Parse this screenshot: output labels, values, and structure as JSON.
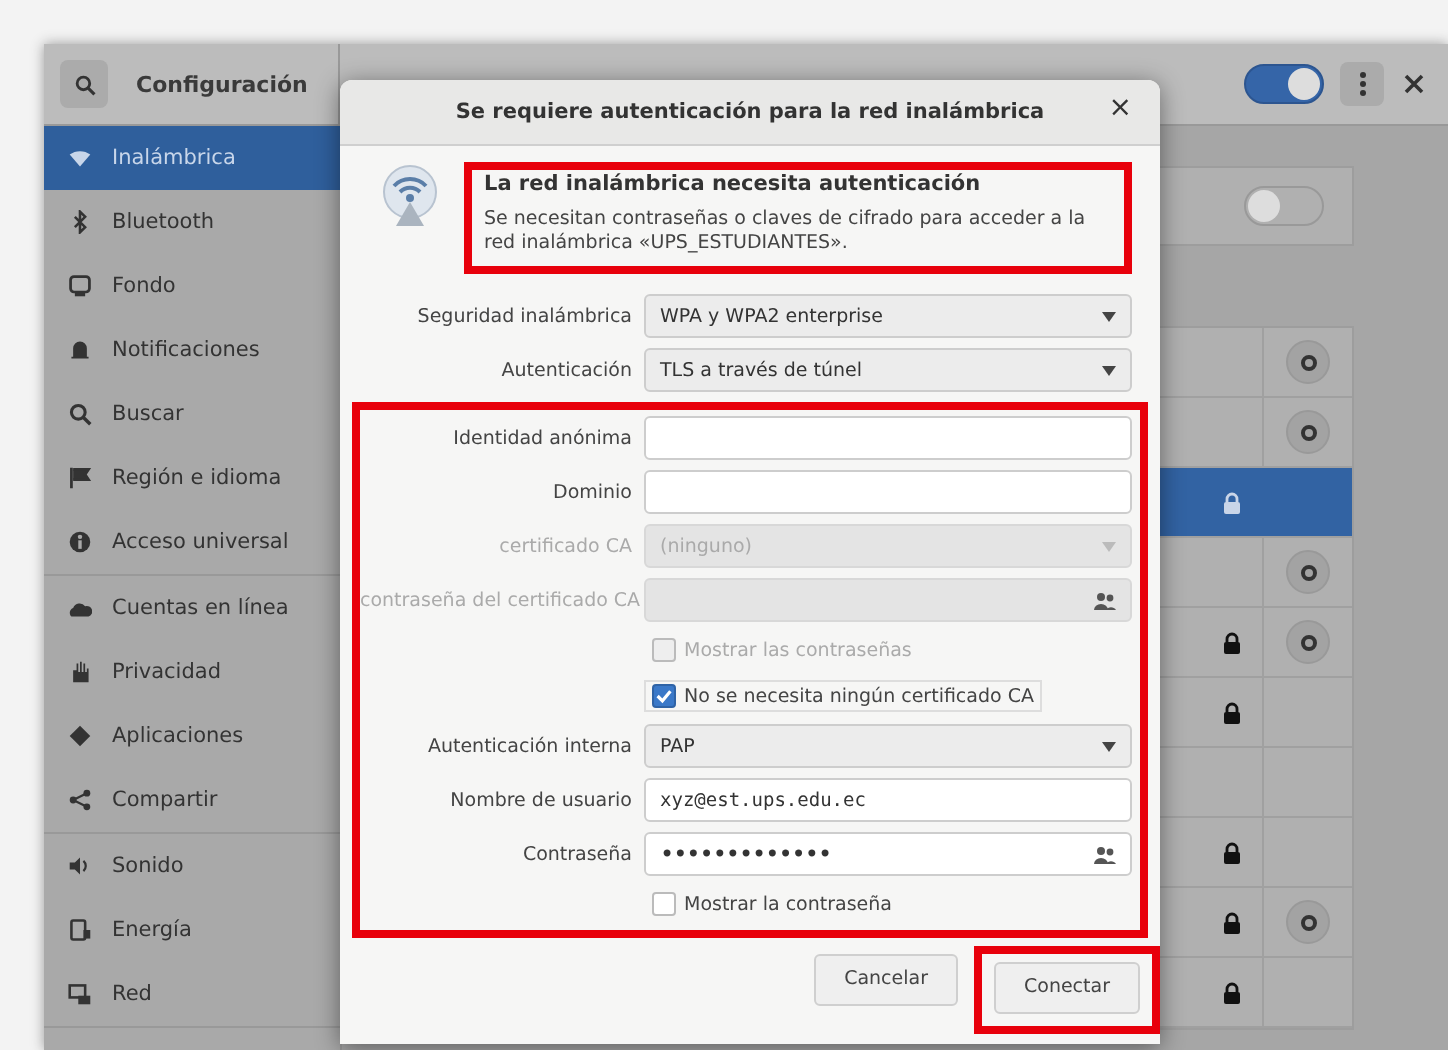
{
  "header": {
    "title": "Configuración",
    "wifi_on": true
  },
  "sidebar": {
    "groups": [
      {
        "items": [
          {
            "label": "Inalámbrica",
            "selected": true
          },
          {
            "label": "Bluetooth",
            "selected": false
          },
          {
            "label": "Fondo",
            "selected": false
          },
          {
            "label": "Notificaciones",
            "selected": false
          },
          {
            "label": "Buscar",
            "selected": false
          },
          {
            "label": "Región e idioma",
            "selected": false
          },
          {
            "label": "Acceso universal",
            "selected": false
          }
        ]
      },
      {
        "items": [
          {
            "label": "Cuentas en línea",
            "selected": false
          },
          {
            "label": "Privacidad",
            "selected": false
          },
          {
            "label": "Aplicaciones",
            "selected": false
          },
          {
            "label": "Compartir",
            "selected": false
          }
        ]
      },
      {
        "items": [
          {
            "label": "Sonido",
            "selected": false
          },
          {
            "label": "Energía",
            "selected": false
          },
          {
            "label": "Red",
            "selected": false
          }
        ]
      }
    ]
  },
  "background": {
    "toggle_on": false,
    "networks": [
      {
        "secured": false,
        "configured": true,
        "selected": false
      },
      {
        "secured": false,
        "configured": true,
        "selected": false
      },
      {
        "secured": true,
        "configured": false,
        "selected": true
      },
      {
        "secured": false,
        "configured": true,
        "selected": false
      },
      {
        "secured": true,
        "configured": true,
        "selected": false
      },
      {
        "secured": true,
        "configured": false,
        "selected": false
      },
      {
        "secured": false,
        "configured": false,
        "selected": false
      },
      {
        "secured": true,
        "configured": false,
        "selected": false
      },
      {
        "secured": true,
        "configured": true,
        "selected": false
      },
      {
        "secured": true,
        "configured": false,
        "selected": false
      }
    ]
  },
  "dialog": {
    "title": "Se requiere autenticación para la red inalámbrica",
    "close": "×",
    "heading": "La red inalámbrica necesita autenticación",
    "description": "Se necesitan contraseñas o claves de cifrado para acceder a la red inalámbrica «UPS_ESTUDIANTES».",
    "top_fields": [
      {
        "kind": "dropdown",
        "label": "Seguridad inalámbrica",
        "value": "WPA y WPA2 enterprise",
        "disabled": false
      },
      {
        "kind": "dropdown",
        "label": "Autenticación",
        "value": "TLS a través de túnel",
        "disabled": false
      }
    ],
    "fields": [
      {
        "kind": "text",
        "label": "Identidad anónima",
        "disabled": false
      },
      {
        "kind": "text",
        "label": "Dominio",
        "disabled": false
      },
      {
        "kind": "dropdown",
        "label": "certificado CA",
        "value": "(ninguno)",
        "disabled": true
      },
      {
        "kind": "password",
        "label": "contraseña del certificado CA",
        "disabled": true
      },
      {
        "kind": "checkbox",
        "label": "Mostrar las contraseñas",
        "checked": false,
        "disabled": true
      },
      {
        "kind": "checkbox",
        "label": "No se necesita ningún certificado CA",
        "checked": true,
        "disabled": false
      },
      {
        "kind": "dropdown",
        "label": "Autenticación interna",
        "value": "PAP",
        "disabled": false
      },
      {
        "kind": "text",
        "label": "Nombre de usuario",
        "value": "xyz@est.ups.edu.ec",
        "disabled": false
      },
      {
        "kind": "password",
        "label": "Contraseña",
        "value": "•••••••••••••",
        "disabled": false
      },
      {
        "kind": "checkbox",
        "label": "Mostrar la contraseña",
        "checked": false,
        "disabled": false
      }
    ],
    "buttons": [
      {
        "label": "Cancelar",
        "highlighted": false
      },
      {
        "label": "Conectar",
        "highlighted": true
      }
    ]
  }
}
